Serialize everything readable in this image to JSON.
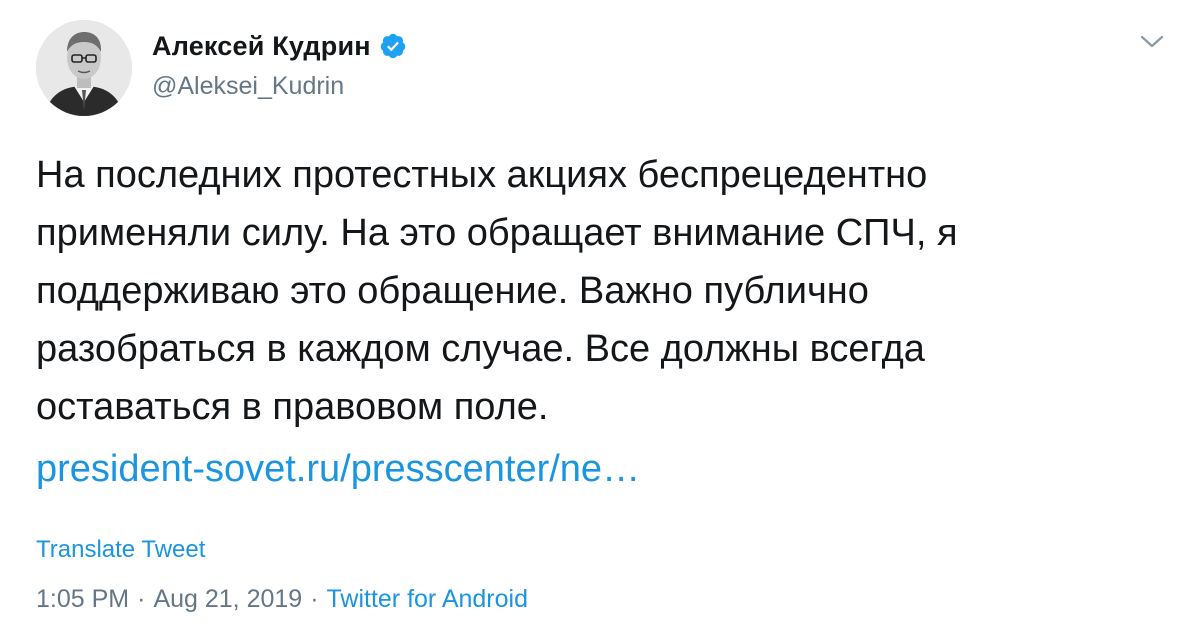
{
  "author": {
    "display_name": "Алексей Кудрин",
    "handle": "@Aleksei_Kudrin",
    "verified": true
  },
  "tweet": {
    "text_lines": [
      "На последних протестных акциях беспрецедентно",
      "применяли силу. На это обращает внимание СПЧ, я",
      "поддерживаю это обращение. Важно публично",
      "разобраться в каждом случае. Все должны всегда",
      "оставаться в правовом поле."
    ],
    "link_text": "president-sovet.ru/presscenter/ne…",
    "translate_label": "Translate Tweet",
    "time": "1:05 PM",
    "separator": "·",
    "date": "Aug 21, 2019",
    "source": "Twitter for Android"
  },
  "icons": {
    "verified": "verified-badge-icon",
    "menu": "chevron-down-icon"
  },
  "colors": {
    "link": "#1b95e0",
    "secondary_text": "#657786",
    "primary_text": "#14171a",
    "verified_badge": "#1da1f2"
  }
}
